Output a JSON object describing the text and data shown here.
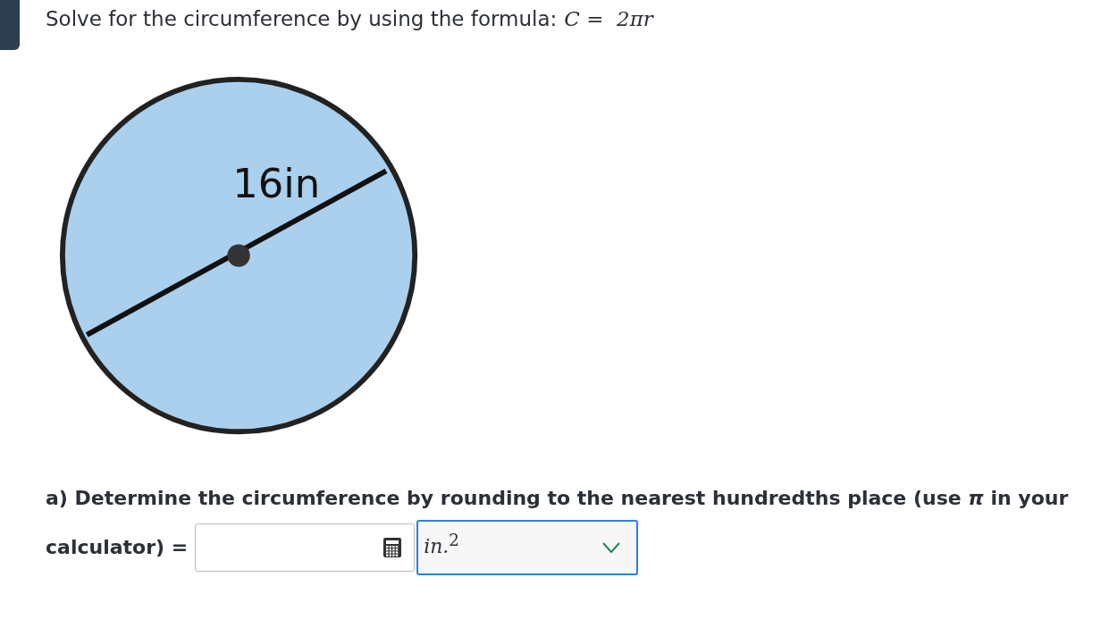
{
  "prompt": {
    "text": "Solve for the circumference by using the formula:",
    "formula": "C =  2πr"
  },
  "diagram": {
    "label": "16in"
  },
  "question": {
    "lines": [
      "a) Determine the circumference by rounding to the nearest hundredths place (use *π* in your",
      "calculator) ="
    ],
    "unit": {
      "value": "*in.*$^{2}$"
    }
  }
}
